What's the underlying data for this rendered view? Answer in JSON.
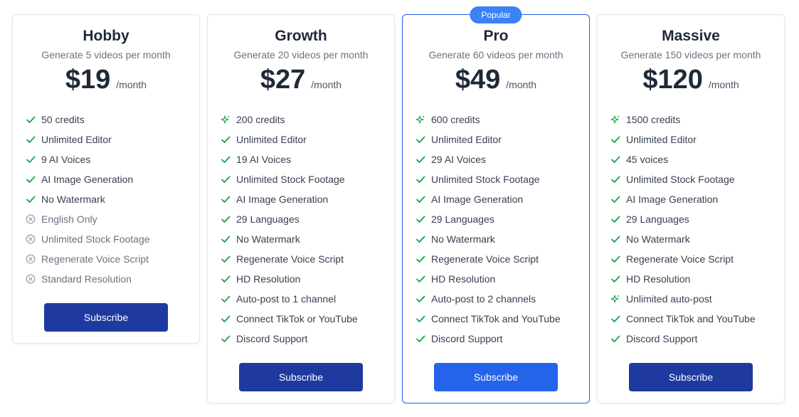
{
  "colors": {
    "check": "#16a34a",
    "cross": "#9ca3af",
    "sparkle": "#16a34a",
    "button": "#1e3a9f",
    "button_popular": "#2563eb",
    "popular_border": "#2563eb",
    "badge": "#3b82f6"
  },
  "plans": [
    {
      "name": "Hobby",
      "subtitle": "Generate 5 videos per month",
      "price": "$19",
      "period": "/month",
      "button": "Subscribe",
      "features": [
        {
          "text": "50 credits",
          "icon": "check-icon"
        },
        {
          "text": "Unlimited Editor",
          "icon": "check-icon"
        },
        {
          "text": "9 AI Voices",
          "icon": "check-icon"
        },
        {
          "text": "AI Image Generation",
          "icon": "check-icon"
        },
        {
          "text": "No Watermark",
          "icon": "check-icon"
        },
        {
          "text": "English Only",
          "icon": "x-circle-icon"
        },
        {
          "text": "Unlimited Stock Footage",
          "icon": "x-circle-icon"
        },
        {
          "text": "Regenerate Voice Script",
          "icon": "x-circle-icon"
        },
        {
          "text": "Standard Resolution",
          "icon": "x-circle-icon"
        }
      ]
    },
    {
      "name": "Growth",
      "subtitle": "Generate 20 videos per month",
      "price": "$27",
      "period": "/month",
      "button": "Subscribe",
      "features": [
        {
          "text": "200 credits",
          "icon": "sparkle-icon"
        },
        {
          "text": "Unlimited Editor",
          "icon": "check-icon"
        },
        {
          "text": "19 AI Voices",
          "icon": "check-icon"
        },
        {
          "text": "Unlimited Stock Footage",
          "icon": "check-icon"
        },
        {
          "text": "AI Image Generation",
          "icon": "check-icon"
        },
        {
          "text": "29 Languages",
          "icon": "check-icon"
        },
        {
          "text": "No Watermark",
          "icon": "check-icon"
        },
        {
          "text": "Regenerate Voice Script",
          "icon": "check-icon"
        },
        {
          "text": "HD Resolution",
          "icon": "check-icon"
        },
        {
          "text": "Auto-post to 1 channel",
          "icon": "check-icon"
        },
        {
          "text": "Connect TikTok or YouTube",
          "icon": "check-icon"
        },
        {
          "text": "Discord Support",
          "icon": "check-icon"
        }
      ]
    },
    {
      "name": "Pro",
      "badge": "Popular",
      "subtitle": "Generate 60 videos per month",
      "price": "$49",
      "period": "/month",
      "button": "Subscribe",
      "features": [
        {
          "text": "600 credits",
          "icon": "sparkle-icon"
        },
        {
          "text": "Unlimited Editor",
          "icon": "check-icon"
        },
        {
          "text": "29 AI Voices",
          "icon": "check-icon"
        },
        {
          "text": "Unlimited Stock Footage",
          "icon": "check-icon"
        },
        {
          "text": "AI Image Generation",
          "icon": "check-icon"
        },
        {
          "text": "29 Languages",
          "icon": "check-icon"
        },
        {
          "text": "No Watermark",
          "icon": "check-icon"
        },
        {
          "text": "Regenerate Voice Script",
          "icon": "check-icon"
        },
        {
          "text": "HD Resolution",
          "icon": "check-icon"
        },
        {
          "text": "Auto-post to 2 channels",
          "icon": "check-icon"
        },
        {
          "text": "Connect TikTok and YouTube",
          "icon": "check-icon"
        },
        {
          "text": "Discord Support",
          "icon": "check-icon"
        }
      ]
    },
    {
      "name": "Massive",
      "subtitle": "Generate 150 videos per month",
      "price": "$120",
      "period": "/month",
      "button": "Subscribe",
      "features": [
        {
          "text": "1500 credits",
          "icon": "sparkle-icon"
        },
        {
          "text": "Unlimited Editor",
          "icon": "check-icon"
        },
        {
          "text": "45 voices",
          "icon": "check-icon"
        },
        {
          "text": "Unlimited Stock Footage",
          "icon": "check-icon"
        },
        {
          "text": "AI Image Generation",
          "icon": "check-icon"
        },
        {
          "text": "29 Languages",
          "icon": "check-icon"
        },
        {
          "text": "No Watermark",
          "icon": "check-icon"
        },
        {
          "text": "Regenerate Voice Script",
          "icon": "check-icon"
        },
        {
          "text": "HD Resolution",
          "icon": "check-icon"
        },
        {
          "text": "Unlimited auto-post",
          "icon": "sparkle-icon"
        },
        {
          "text": "Connect TikTok and YouTube",
          "icon": "check-icon"
        },
        {
          "text": "Discord Support",
          "icon": "check-icon"
        }
      ]
    }
  ]
}
